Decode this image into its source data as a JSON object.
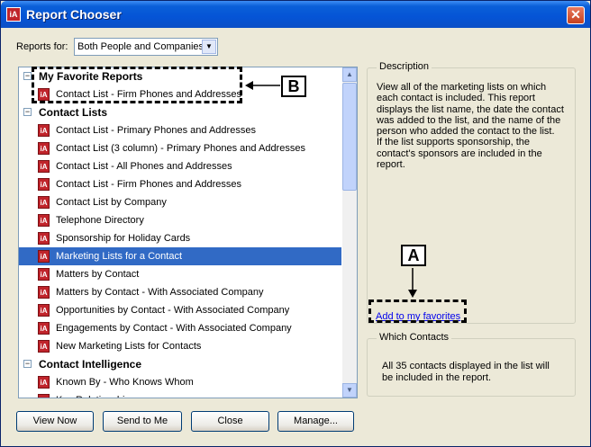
{
  "window": {
    "title": "Report Chooser",
    "close_symbol": "✕"
  },
  "reports_for": {
    "label": "Reports for:",
    "value": "Both People and Companies"
  },
  "tree": {
    "headers": [
      "My Favorite Reports",
      "Contact Lists",
      "Contact Intelligence"
    ],
    "favorites": [
      "Contact List - Firm Phones and Addresses"
    ],
    "contact_lists": [
      "Contact List - Primary Phones and Addresses",
      "Contact List (3 column) - Primary Phones and Addresses",
      "Contact List - All Phones and Addresses",
      "Contact List - Firm Phones and Addresses",
      "Contact List by Company",
      "Telephone Directory",
      "Sponsorship for Holiday Cards",
      "Marketing Lists for a Contact",
      "Matters by Contact",
      "Matters by Contact - With Associated Company",
      "Opportunities by Contact - With Associated Company",
      "Engagements by Contact - With Associated Company",
      "New Marketing Lists for Contacts"
    ],
    "contact_intelligence": [
      "Known By - Who Knows Whom",
      "Key Relationships"
    ],
    "selected": "Marketing Lists for a Contact",
    "expander_symbol": "−"
  },
  "description": {
    "title": "Description",
    "text": "View all of the marketing lists on which each contact is included.  This report displays the list name, the date the contact was added to the list, and the name of the person who added the contact to the list.\nIf the list supports sponsorship, the contact's sponsors are included in the report.",
    "link": "Add to my favorites"
  },
  "which_contacts": {
    "title": "Which Contacts",
    "text": "All 35 contacts displayed in the list will be included in the report."
  },
  "buttons": {
    "view_now": "View Now",
    "send_to_me": "Send to Me",
    "close": "Close",
    "manage": "Manage..."
  },
  "callouts": {
    "a": "A",
    "b": "B"
  }
}
